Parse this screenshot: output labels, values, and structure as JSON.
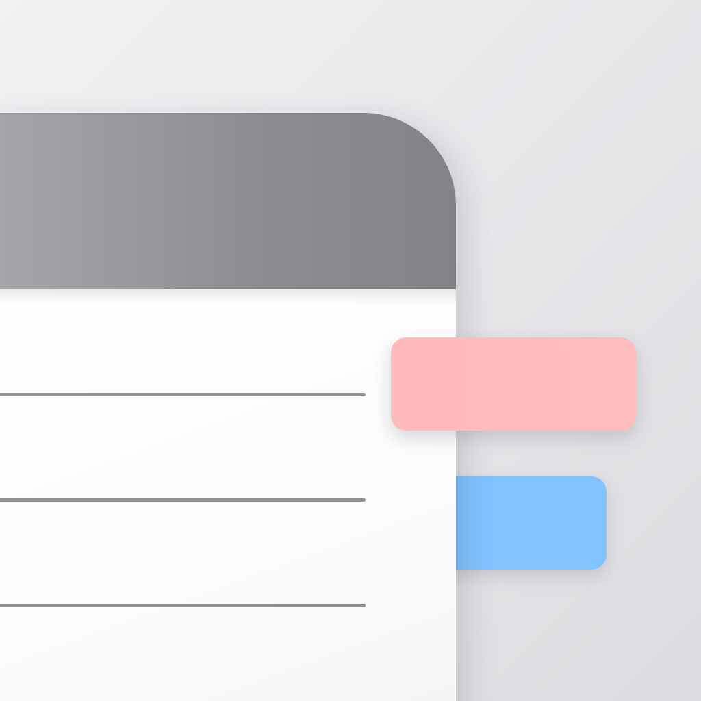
{
  "app_icon": {
    "icon": "notepad-with-tabs-icon",
    "colors": {
      "background": "#e8e8eb",
      "header": "#8c8c91",
      "page": "#ffffff",
      "rule_line": "#909091",
      "tab_pink": "#ffbabc",
      "tab_blue": "#80c3ff"
    },
    "ruled_lines": 3,
    "tabs": [
      {
        "name": "pink-tab",
        "color": "#ffbabc"
      },
      {
        "name": "blue-tab",
        "color": "#80c3ff"
      }
    ]
  }
}
